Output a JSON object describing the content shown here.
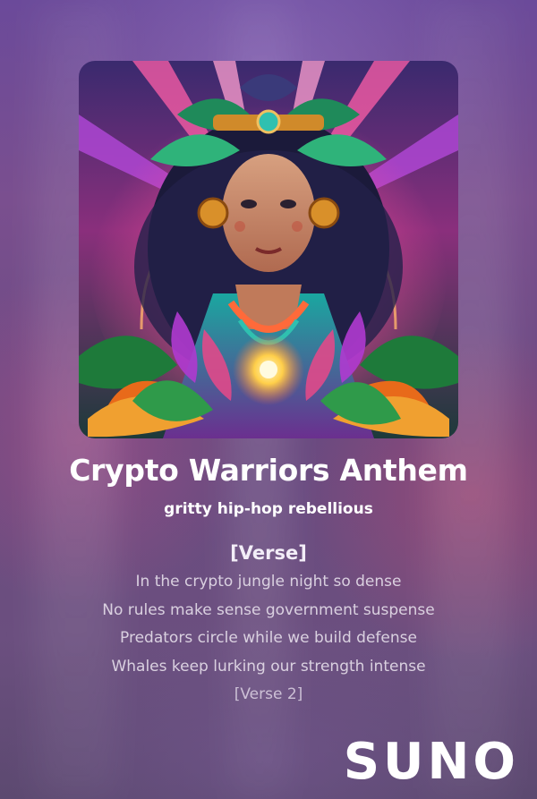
{
  "song": {
    "title": "Crypto Warriors Anthem",
    "style": "gritty hip-hop rebellious"
  },
  "cover_art": {
    "description_icon": "album-cover-image"
  },
  "lyrics": {
    "section_label": "[Verse]",
    "lines": [
      "In the crypto jungle night so dense",
      "No rules make sense government suspense",
      "Predators circle while we build defense",
      "Whales keep lurking our strength intense"
    ],
    "next_section": "[Verse 2]"
  },
  "brand": {
    "logo_text": "SUNO"
  },
  "colors": {
    "background_top": "#6b4a9a",
    "background_bottom": "#5c4970",
    "text": "#ffffff"
  }
}
